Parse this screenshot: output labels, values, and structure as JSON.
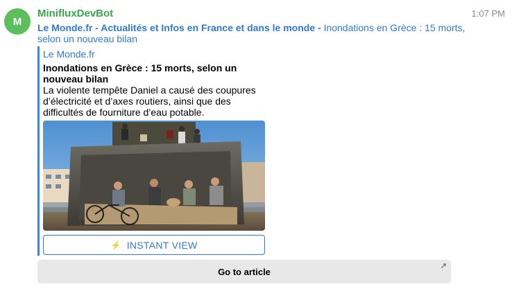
{
  "colors": {
    "avatar_bg": "#5cbf5b",
    "sender": "#3aa64a",
    "link": "#2f7ad0",
    "accent_bar": "#3a86d9",
    "goto_bg": "#e8e8e8"
  },
  "message": {
    "avatar_initial": "M",
    "sender": "MinifluxDevBot",
    "time": "1:07 PM",
    "source_link": "Le Monde.fr - Actualités et Infos en France et dans le monde",
    "separator": " - ",
    "headline_link": "Inondations en Grèce : 15 morts, selon un nouveau bilan"
  },
  "preview": {
    "site": "Le Monde.fr",
    "title": "Inondations en Grèce : 15 morts, selon un nouveau bilan",
    "description": "La violente tempête Daniel a causé des coupures d’électricité et d’axes routiers, ainsi que des difficultés de fourniture d’eau potable.",
    "image_alt": "Men sitting in a bulldozer bucket with a bicycle and a dog in flooded streets"
  },
  "buttons": {
    "instant_view_icon": "lightning-icon",
    "instant_view": "INSTANT VIEW",
    "goto_article": "Go to article",
    "goto_icon": "external-link-arrow-icon"
  }
}
